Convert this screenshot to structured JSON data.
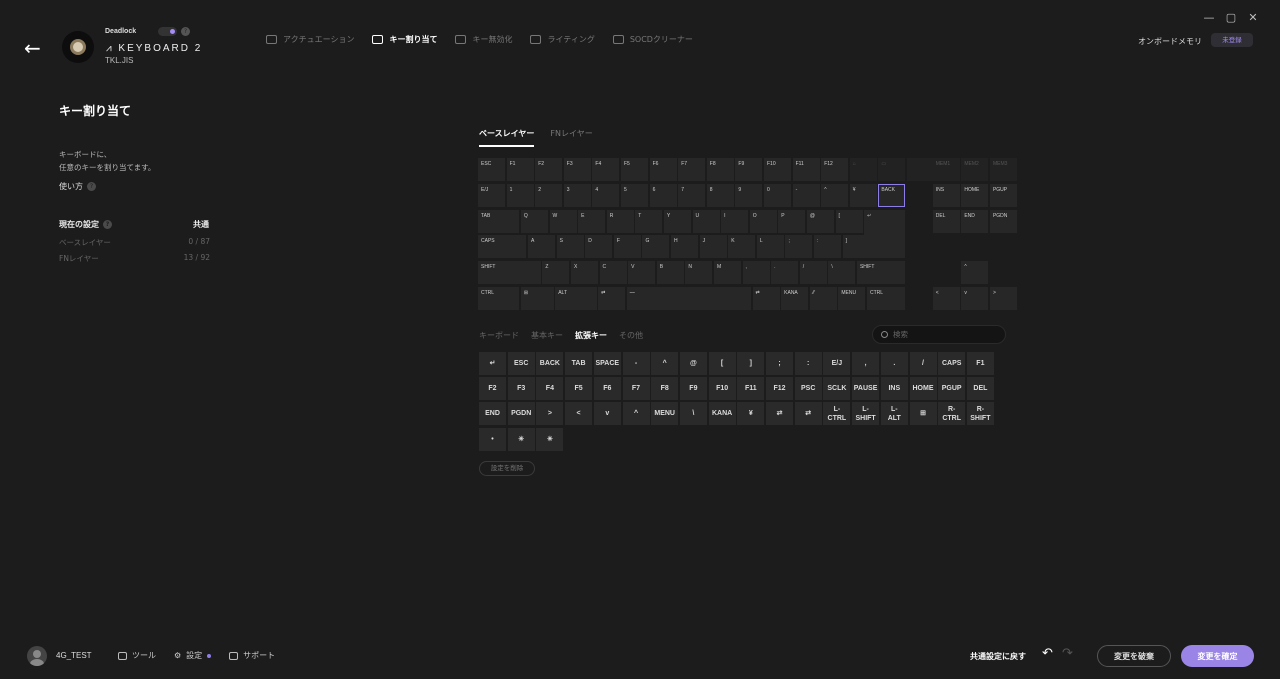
{
  "window": {
    "minimize_icon": "minimize-icon",
    "maximize_icon": "maximize-icon",
    "close_icon": "close-icon"
  },
  "device": {
    "profile_name": "Deadlock",
    "name": "KEYBOARD 2",
    "layout": "TKL.JIS"
  },
  "topnav": [
    {
      "label": "アクチュエーション",
      "icon": "actuation-icon",
      "active": false
    },
    {
      "label": "キー割り当て",
      "icon": "key-assign-icon",
      "active": true
    },
    {
      "label": "キー無効化",
      "icon": "key-disable-icon",
      "active": false
    },
    {
      "label": "ライティング",
      "icon": "lighting-icon",
      "active": false
    },
    {
      "label": "SOCDクリーナー",
      "icon": "socd-icon",
      "active": false
    }
  ],
  "onboard": {
    "label": "オンボードメモリ",
    "badge": "未登録"
  },
  "left": {
    "title": "キー割り当て",
    "desc_line1": "キーボードに、",
    "desc_line2": "任意のキーを割り当てます。",
    "howto": "使い方",
    "current_label": "現在の設定",
    "current_value": "共通",
    "base_label": "ベースレイヤー",
    "base_count": "0 / 87",
    "fn_label": "FNレイヤー",
    "fn_count": "13 / 92"
  },
  "layer_tabs": [
    {
      "label": "ベースレイヤー",
      "active": true
    },
    {
      "label": "FNレイヤー",
      "active": false
    }
  ],
  "keyboard_rows": [
    [
      "ESC",
      "F1",
      "F2",
      "F3",
      "F4",
      "F5",
      "F6",
      "F7",
      "F8",
      "F9",
      "F10",
      "F11",
      "F12",
      "⌂",
      "▭",
      "",
      "MEM1",
      "MEM2",
      "MEM3"
    ],
    [
      "E/J",
      "1",
      "2",
      "3",
      "4",
      "5",
      "6",
      "7",
      "8",
      "9",
      "0",
      "-",
      "^",
      "¥",
      "BACK",
      "INS",
      "HOME",
      "PGUP"
    ],
    [
      "TAB",
      "Q",
      "W",
      "E",
      "R",
      "T",
      "Y",
      "U",
      "I",
      "O",
      "P",
      "@",
      "[",
      "↵",
      "DEL",
      "END",
      "PGDN"
    ],
    [
      "CAPS",
      "A",
      "S",
      "D",
      "F",
      "G",
      "H",
      "J",
      "K",
      "L",
      ";",
      ":",
      "]"
    ],
    [
      "SHIFT",
      "Z",
      "X",
      "C",
      "V",
      "B",
      "N",
      "M",
      ",",
      ".",
      "/",
      "\\",
      "SHIFT",
      "^"
    ],
    [
      "CTRL",
      "⊞",
      "ALT",
      "⇄",
      "⎯⎯",
      "⇄",
      "KANA",
      "⁄⁄",
      "MENU",
      "CTRL",
      "<",
      "v",
      ">"
    ]
  ],
  "category_tabs": [
    {
      "label": "キーボード",
      "active": false
    },
    {
      "label": "基本キー",
      "active": false
    },
    {
      "label": "拡張キー",
      "active": true
    },
    {
      "label": "その他",
      "active": false
    }
  ],
  "search": {
    "placeholder": "検索"
  },
  "palette": [
    "↵",
    "ESC",
    "BACK",
    "TAB",
    "SPACE",
    "-",
    "^",
    "@",
    "[",
    "]",
    ";",
    ":",
    "E/J",
    ",",
    ".",
    "/",
    "CAPS",
    "F1",
    "F2",
    "F3",
    "F4",
    "F5",
    "F6",
    "F7",
    "F8",
    "F9",
    "F10",
    "F11",
    "F12",
    "PSC",
    "SCLK",
    "PAUSE",
    "INS",
    "HOME",
    "PGUP",
    "DEL",
    "END",
    "PGDN",
    ">",
    "<",
    "v",
    "^",
    "MENU",
    "\\",
    "KANA",
    "¥",
    "⇄",
    "⇄",
    "L-\nCTRL",
    "L-\nSHIFT",
    "L-\nALT",
    "⊞",
    "R-\nCTRL",
    "R-\nSHIFT",
    "•",
    "✳",
    "✳"
  ],
  "clear_button": "設定を削除",
  "footer": {
    "username": "4G_TEST",
    "tools": "ツール",
    "settings": "設定",
    "support": "サポート",
    "reset_common": "共通設定に戻す",
    "discard": "変更を破棄",
    "confirm": "変更を確定"
  },
  "colors": {
    "accent": "#9a85e6",
    "background": "#1c1c1c",
    "key": "#272727"
  }
}
